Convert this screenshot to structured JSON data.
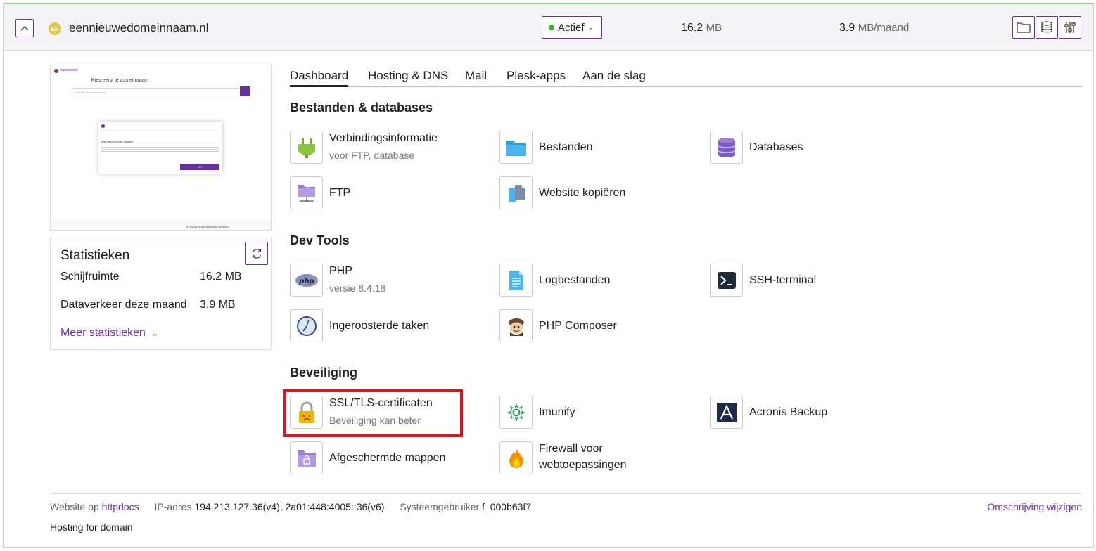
{
  "header": {
    "domain_logo_text": "EE",
    "domain": "eennieuwedomeinnaam.nl",
    "status_label": "Actief",
    "disk_value": "16.2",
    "disk_unit": "MB",
    "traffic_value": "3.9",
    "traffic_unit": "MB/maand",
    "icons": [
      "folder-icon",
      "database-icon",
      "sliders-icon"
    ]
  },
  "stats": {
    "title": "Statistieken",
    "rows": [
      {
        "label": "Schijfruimte",
        "value": "16.2 MB"
      },
      {
        "label": "Dataverkeer deze maand",
        "value": "3.9 MB"
      }
    ],
    "more_label": "Meer statistieken"
  },
  "tabs": [
    "Dashboard",
    "Hosting & DNS",
    "Mail",
    "Plesk-apps",
    "Aan de slag"
  ],
  "sections": {
    "files_title": "Bestanden & databases",
    "dev_title": "Dev Tools",
    "security_title": "Beveiliging"
  },
  "tiles": {
    "conn": {
      "label": "Verbindingsinformatie",
      "sub": "voor FTP, database"
    },
    "files": {
      "label": "Bestanden"
    },
    "databases": {
      "label": "Databases"
    },
    "ftp": {
      "label": "FTP"
    },
    "copy": {
      "label": "Website kopiëren"
    },
    "php": {
      "label": "PHP",
      "sub": "versie 8.4.18"
    },
    "logs": {
      "label": "Logbestanden"
    },
    "ssh": {
      "label": "SSH-terminal"
    },
    "cron": {
      "label": "Ingeroosterde taken"
    },
    "composer": {
      "label": "PHP Composer"
    },
    "ssl": {
      "label": "SSL/TLS-certificaten",
      "sub": "Beveiliging kan beter"
    },
    "imunify": {
      "label": "Imunify"
    },
    "acronis": {
      "label": "Acronis Backup"
    },
    "protected": {
      "label": "Afgeschermde mappen"
    },
    "firewall": {
      "label_1": "Firewall voor",
      "label_2": "webtoepassingen"
    }
  },
  "footer": {
    "website_prefix": "Website op",
    "website_link": "httpdocs",
    "ip_prefix": "IP-adres",
    "ip_value": "194.213.127.36(v4), 2a01:448:4005::36(v6)",
    "user_prefix": "Systeemgebruiker",
    "user_value": "f_000b63f7",
    "edit_link": "Omschrijving wijzigen",
    "hosting_text": "Hosting for domain"
  },
  "preview": {
    "brand": "mijndomein",
    "heading": "Kies eerst je domeinnaam",
    "placeholder": "Voer hier je domeinnaam",
    "dialog_title": "Wie website voor cookies",
    "dialog_button": "OK",
    "bottom_text": "Ik heb geen domeinnaam gekozen"
  },
  "colors": {
    "accent": "#6a2fa6",
    "status_active": "#3db22b",
    "highlight": "#e0141e"
  }
}
